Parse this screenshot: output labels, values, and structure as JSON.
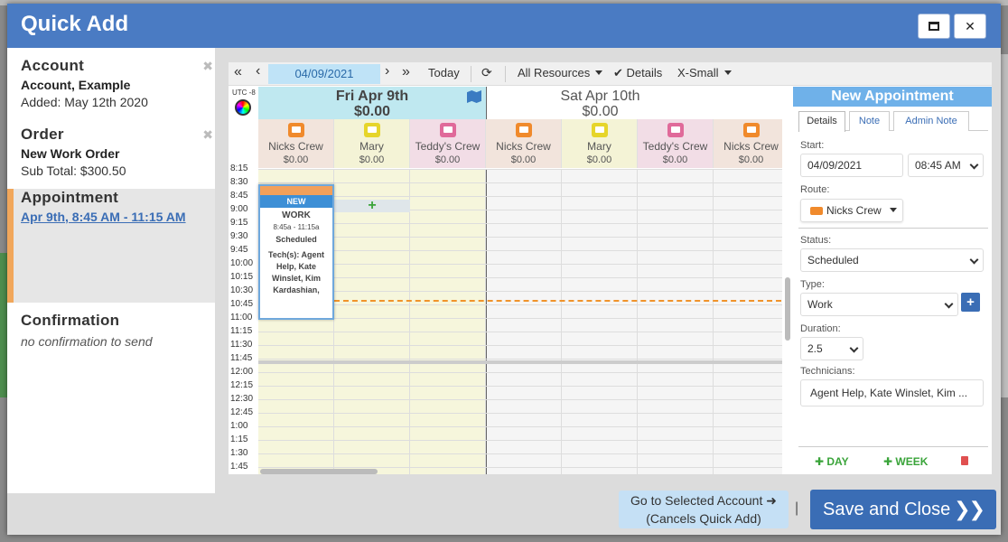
{
  "modal": {
    "title": "Quick Add"
  },
  "sidebar": {
    "account": {
      "heading": "Account",
      "name": "Account, Example",
      "added": "Added: May 12th 2020"
    },
    "order": {
      "heading": "Order",
      "name": "New Work Order",
      "subtotal": "Sub Total: $300.50"
    },
    "appointment": {
      "heading": "Appointment",
      "link": "Apr 9th, 8:45 AM - 11:15 AM"
    },
    "confirmation": {
      "heading": "Confirmation",
      "note": "no confirmation to send"
    }
  },
  "toolbar": {
    "date": "04/09/2021",
    "today": "Today",
    "resources": "All Resources",
    "details": "Details",
    "size": "X-Small"
  },
  "calendar": {
    "timezone": "UTC -8",
    "days": [
      {
        "label": "Fri Apr 9th",
        "total": "$0.00"
      },
      {
        "label": "Sat Apr 10th",
        "total": "$0.00"
      }
    ],
    "resources": [
      {
        "name": "Nicks Crew",
        "amount": "$0.00",
        "color": "#f08a2c",
        "bg": "#f2e4dc"
      },
      {
        "name": "Mary",
        "amount": "$0.00",
        "color": "#e6d52a",
        "bg": "#f4f3d6"
      },
      {
        "name": "Teddy's Crew",
        "amount": "$0.00",
        "color": "#e06a9a",
        "bg": "#f2dde6"
      },
      {
        "name": "Nicks Crew",
        "amount": "$0.00",
        "color": "#f08a2c",
        "bg": "#f2e4dc"
      },
      {
        "name": "Mary",
        "amount": "$0.00",
        "color": "#e6d52a",
        "bg": "#f4f3d6"
      },
      {
        "name": "Teddy's Crew",
        "amount": "$0.00",
        "color": "#e06a9a",
        "bg": "#f2dde6"
      },
      {
        "name": "Nicks Crew",
        "amount": "$0.00",
        "color": "#f08a2c",
        "bg": "#f2e4dc"
      }
    ],
    "times": [
      "8:15",
      "8:30",
      "8:45",
      "9:00",
      "9:15",
      "9:30",
      "9:45",
      "10:00",
      "10:15",
      "10:30",
      "10:45",
      "11:00",
      "11:15",
      "11:30",
      "11:45",
      "12:00",
      "12:15",
      "12:30",
      "12:45",
      "1:00",
      "1:15",
      "1:30",
      "1:45"
    ],
    "appointment_card": {
      "badge": "NEW",
      "type": "WORK",
      "time": "8:45a - 11:15a",
      "status": "Scheduled",
      "techs": "Tech(s): Agent Help, Kate Winslet, Kim Kardashian,"
    }
  },
  "new_appointment": {
    "title": "New Appointment",
    "tabs": [
      "Details",
      "Note",
      "Admin Note"
    ],
    "start_label": "Start:",
    "start_date": "04/09/2021",
    "start_time": "08:45 AM",
    "route_label": "Route:",
    "route": "Nicks Crew",
    "status_label": "Status:",
    "status": "Scheduled",
    "type_label": "Type:",
    "type": "Work",
    "duration_label": "Duration:",
    "duration": "2.5",
    "technicians_label": "Technicians:",
    "technicians": "Agent Help, Kate Winslet, Kim ...",
    "day_button": "DAY",
    "week_button": "WEEK"
  },
  "footer": {
    "goto_line1": "Go to Selected Account",
    "goto_line2": "(Cancels Quick Add)",
    "separator": "|",
    "save": "Save and Close"
  }
}
